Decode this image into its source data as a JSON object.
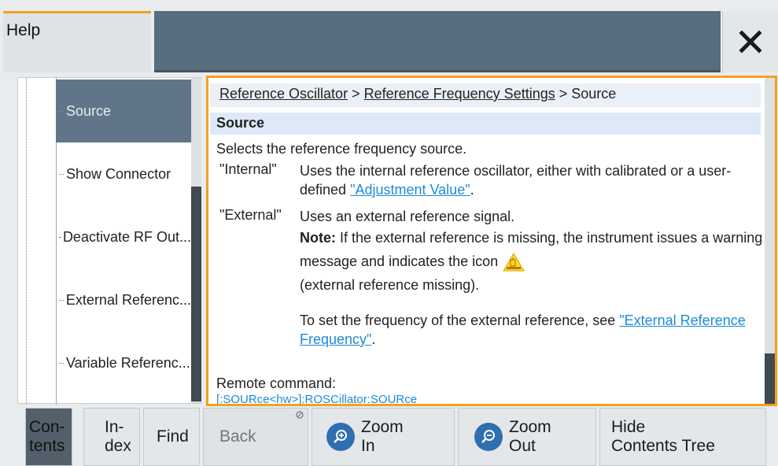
{
  "window": {
    "title": "Help",
    "close_glyph": "✕"
  },
  "tree": {
    "items": [
      {
        "label": "Source",
        "selected": true
      },
      {
        "label": "Show Connector",
        "selected": false
      },
      {
        "label": "Deactivate RF Out...",
        "selected": false
      },
      {
        "label": "External Referenc...",
        "selected": false
      },
      {
        "label": "Variable Referenc...",
        "selected": false
      }
    ]
  },
  "content": {
    "breadcrumb": {
      "crumb1": "Reference Oscillator",
      "sep1": " > ",
      "crumb2": "Reference Frequency Settings",
      "sep2": " > ",
      "current": "Source"
    },
    "heading": "Source",
    "description": "Selects the reference frequency source.",
    "internal": {
      "term": "\"Internal\"",
      "text": "Uses the internal reference oscillator, either with calibrated or a user-defined ",
      "link": "\"Adjustment Value\"",
      "tail": "."
    },
    "external": {
      "term": "\"External\"",
      "line1": "Uses an external reference signal.",
      "note_label": "Note:",
      "note_text": " If the external reference is missing, the instrument issues a warning message and indicates the icon",
      "icon_caption": "(external reference missing).",
      "para2": "To set the frequency of the external reference, see ",
      "para2_link": "\"External Reference Frequency\"",
      "para2_tail": "."
    },
    "remote_label": "Remote command:",
    "remote_cmd": "[:SOURce<hw>]:ROSCillator:SOURce"
  },
  "toolbar": {
    "contents_line1": "Con-",
    "contents_line2": "tents",
    "index_line1": "In-",
    "index_line2": "dex",
    "find": "Find",
    "back": "Back",
    "zoom_in_line1": "Zoom",
    "zoom_in_line2": "In",
    "zoom_out_line1": "Zoom",
    "zoom_out_line2": "Out",
    "hide_line1": "Hide",
    "hide_line2": "Contents Tree"
  },
  "icons": {
    "close": "close-icon",
    "zoom_in": "zoom-in-icon",
    "zoom_out": "zoom-out-icon",
    "warning": "external-reference-missing-icon"
  },
  "colors": {
    "accent": "#f0a21e",
    "title_bar": "#586d7e",
    "link": "#1e8bd6",
    "selected": "#607688"
  }
}
